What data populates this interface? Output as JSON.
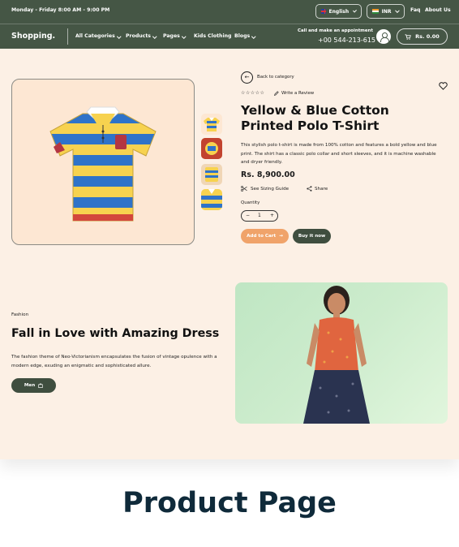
{
  "topbar": {
    "hours": "Monday - Friday  8:00 AM - 9:00 PM",
    "language": "English",
    "currency": "INR",
    "links": [
      "Faq",
      "About Us"
    ]
  },
  "nav": {
    "logo": "Shopping.",
    "items": [
      "All Categories",
      "Products",
      "Pages",
      "Kids Clothing",
      "Blogs"
    ],
    "call_label": "Call and make an appointment",
    "call_number": "+00 544-213-615",
    "cart_total": "Rs. 0.00"
  },
  "product": {
    "back_label": "Back to category",
    "review_label": "Write a Review",
    "rating": 0,
    "stars": "☆☆☆☆☆",
    "title": "Yellow & Blue Cotton Printed Polo T-Shirt",
    "description": "This stylish polo t-shirt is made from 100% cotton and features a bold yellow and blue print. The shirt has a classic polo collar and short sleeves, and it is machine washable and dryer friendly.",
    "price": "Rs. 8,900.00",
    "size_guide": "See Sizing Guide",
    "share": "Share",
    "quantity_label": "Quantity",
    "quantity": "1",
    "add_to_cart": "Add to Cart",
    "buy_now": "Buy it now"
  },
  "promo": {
    "eyebrow": "Fashion",
    "title": "Fall in Love with Amazing Dress",
    "text": "The fashion theme of Neo-Victorianism encapsulates the fusion of vintage opulence with a modern edge, exuding an enigmatic and sophisticated allure.",
    "button": "Men"
  },
  "caption": "Product Page",
  "colors": {
    "header_bg": "#455645",
    "page_bg": "#fcf0e5",
    "accent_orange": "#f0a36a",
    "dark_button": "#3f4e3f",
    "caption": "#0f2a3a"
  },
  "icons": [
    "uk-flag-icon",
    "india-flag-icon",
    "user-icon",
    "cart-icon",
    "back-arrow-icon",
    "heart-icon",
    "pencil-icon",
    "scissors-icon",
    "share-icon",
    "bag-icon"
  ]
}
